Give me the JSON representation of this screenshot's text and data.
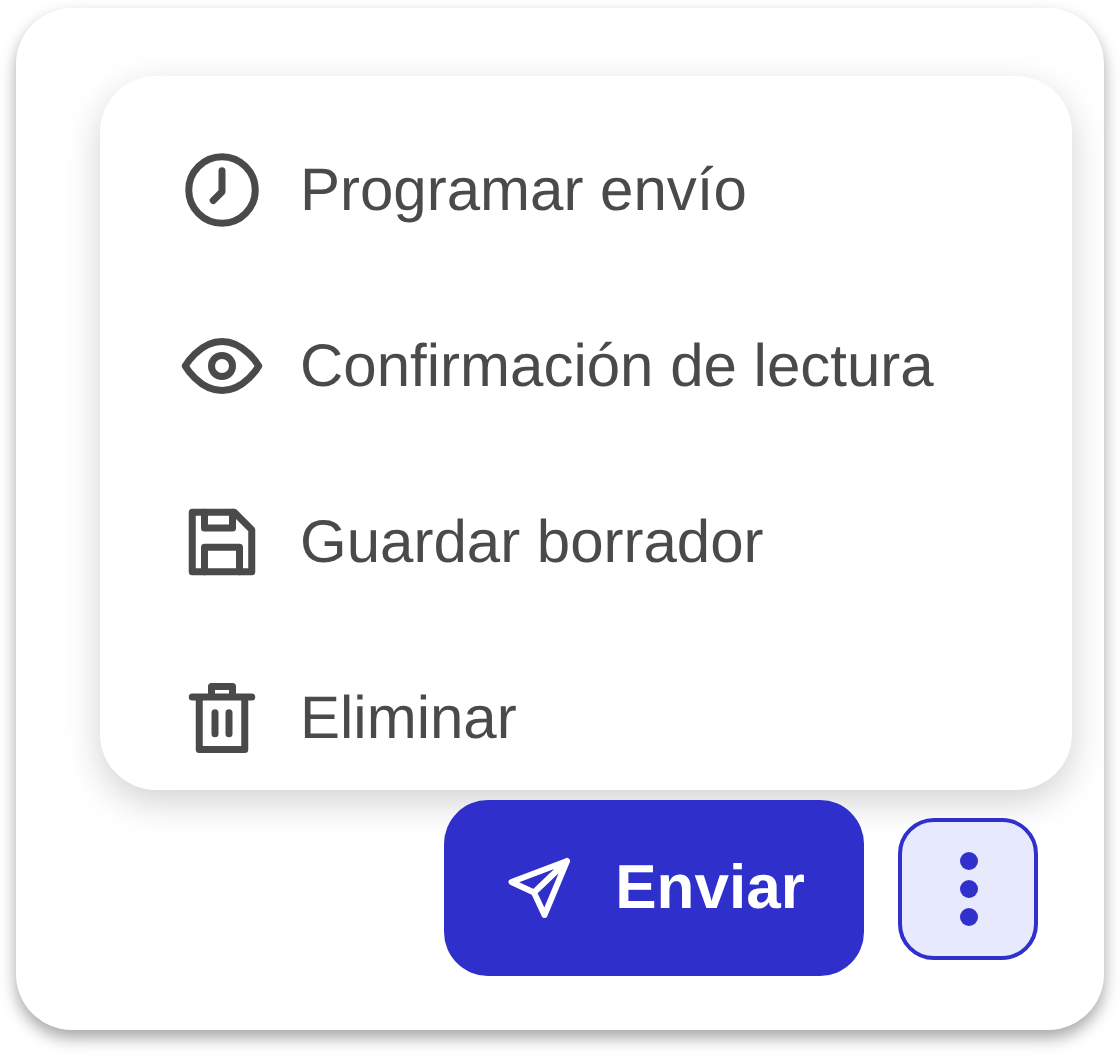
{
  "menu": {
    "items": [
      {
        "kind": "schedule",
        "label": "Programar envío"
      },
      {
        "kind": "read-receipt",
        "label": "Confirmación de lectura"
      },
      {
        "kind": "save",
        "label": "Guardar borrador"
      },
      {
        "kind": "delete",
        "label": "Eliminar"
      }
    ]
  },
  "send_button": {
    "label": "Enviar"
  },
  "more_button": {
    "expanded": true
  }
}
